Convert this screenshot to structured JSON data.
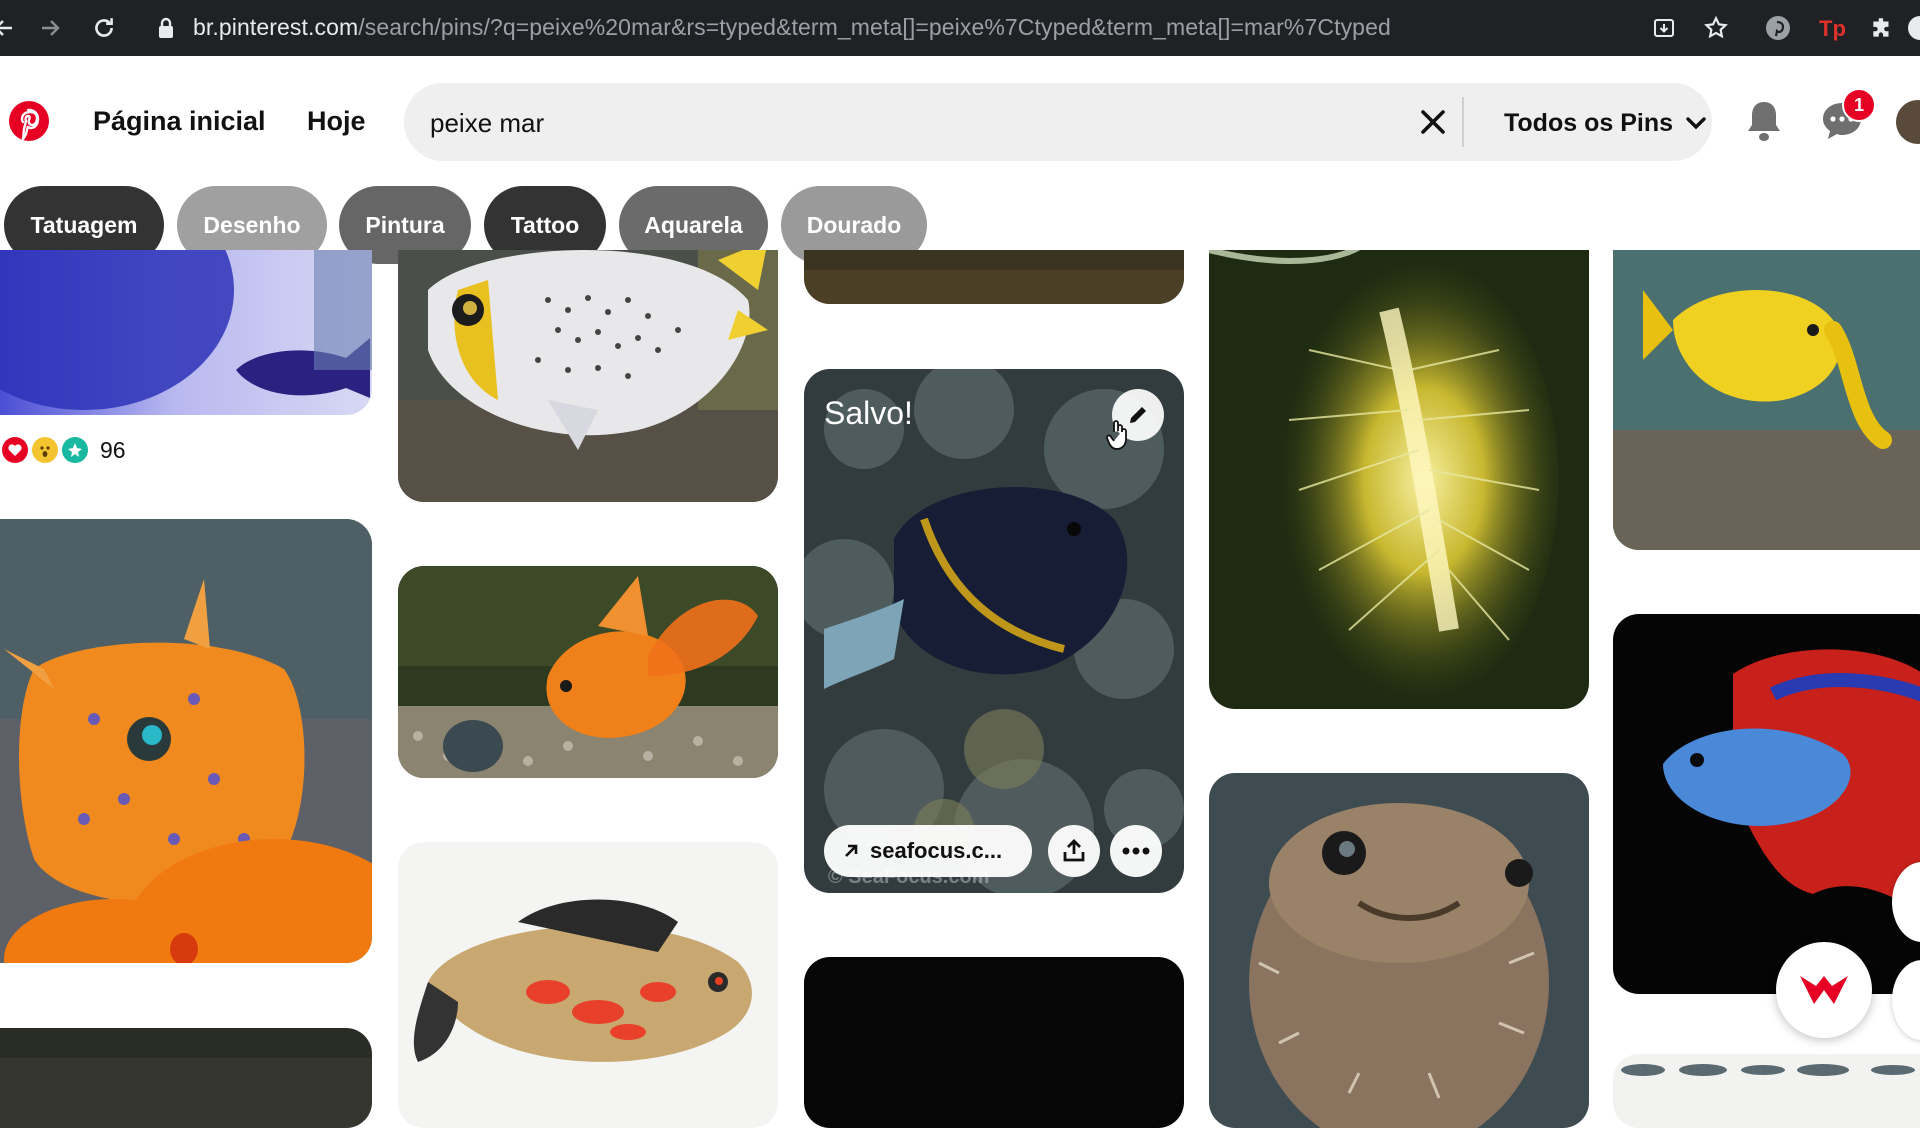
{
  "browser": {
    "url_host": "br.pinterest.com",
    "url_path": "/search/pins/?q=peixe%20mar&rs=typed&term_meta[]=peixe%7Ctyped&term_meta[]=mar%7Ctyped"
  },
  "header": {
    "nav": [
      "Página inicial",
      "Hoje"
    ],
    "search_value": "peixe mar",
    "filter_label": "Todos os Pins",
    "message_badge": "1"
  },
  "chips": [
    {
      "label": "Tatuagem",
      "color": "#333333"
    },
    {
      "label": "Desenho",
      "color": "#a0a0a0"
    },
    {
      "label": "Pintura",
      "color": "#666666"
    },
    {
      "label": "Tattoo",
      "color": "#333333"
    },
    {
      "label": "Aquarela",
      "color": "#6b6b6b"
    },
    {
      "label": "Dourado",
      "color": "#9a9a9a"
    }
  ],
  "pins": {
    "reactions_count": "96",
    "hovered": {
      "status": "Salvo!",
      "link_label": "seafocus.c...",
      "watermark": "© SeaFocus.com"
    }
  },
  "colors": {
    "brand": "#e60023",
    "chrome_bg": "#202124",
    "search_bg": "#efefef"
  }
}
